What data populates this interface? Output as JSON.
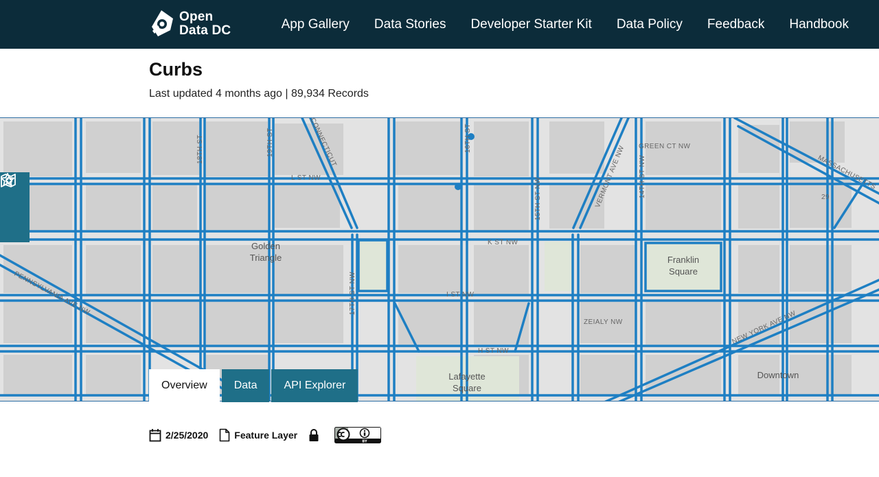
{
  "brand": {
    "line1": "Open",
    "line2": "Data DC"
  },
  "nav": {
    "items": [
      {
        "label": "App Gallery"
      },
      {
        "label": "Data Stories"
      },
      {
        "label": "Developer Starter Kit"
      },
      {
        "label": "Data Policy"
      },
      {
        "label": "Feedback"
      },
      {
        "label": "Handbook"
      }
    ]
  },
  "dataset": {
    "title": "Curbs",
    "meta": "Last updated 4 months ago | 89,934 Records"
  },
  "map": {
    "area_labels": [
      "Golden Triangle",
      "Franklin Square",
      "Lafayette Square",
      "Downtown"
    ],
    "street_labels": [
      "CONNECTICUT",
      "PENNSYLVANIA AVE NW",
      "17TH ST NW",
      "16TH ST",
      "15TH ST NW",
      "14TH ST NW",
      "VERMONT AVE NW",
      "MASSACHUSETTS",
      "L ST NW",
      "K ST NW",
      "I ST NW",
      "H ST NW",
      "ZEIALY NW",
      "GREEN CT NW",
      "18TH ST",
      "19TH ST",
      "NEW YORK AVE NW"
    ],
    "route_badge": "29",
    "colors": {
      "curb": "#1e7fc3",
      "background": "#e3e3e3",
      "block": "#d2d2d2",
      "park": "#dfe6d8"
    },
    "tools": [
      {
        "icon": "star-icon"
      },
      {
        "icon": "add-map-icon"
      }
    ]
  },
  "tabs": [
    {
      "label": "Overview",
      "active": true
    },
    {
      "label": "Data",
      "active": false
    },
    {
      "label": "API Explorer",
      "active": false
    }
  ],
  "details": {
    "date": "2/25/2020",
    "type": "Feature Layer",
    "license_badge": "cc-by-icon"
  }
}
